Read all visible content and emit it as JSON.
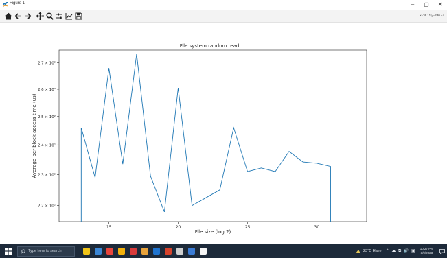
{
  "window": {
    "title": "Figure 1",
    "minimize": "–",
    "maximize": "▢",
    "close": "✕"
  },
  "toolbar": {
    "buttons": [
      "home-icon",
      "back-icon",
      "forward-icon",
      "pan-icon",
      "zoom-icon",
      "configure-subplots-icon",
      "edit-axis-icon",
      "save-icon"
    ],
    "coords": "x=36.11 y=230.44"
  },
  "chart_data": {
    "type": "line",
    "title": "File system random read",
    "xlabel": "File size (log 2)",
    "ylabel": "Average per block access time (us)",
    "xlim": [
      11.4,
      33.6
    ],
    "ylim": [
      215,
      275
    ],
    "yscale": "log",
    "grid": false,
    "legend": "none",
    "line_color": "#1f77b4",
    "x_ticks": [
      {
        "value": 15,
        "label": "15"
      },
      {
        "value": 20,
        "label": "20"
      },
      {
        "value": 25,
        "label": "25"
      },
      {
        "value": 30,
        "label": "30"
      }
    ],
    "y_ticks": [
      {
        "value": 220,
        "label": "2.2 × 10²"
      },
      {
        "value": 230,
        "label": "2.3 × 10²"
      },
      {
        "value": 240,
        "label": "2.4 × 10²"
      },
      {
        "value": 250,
        "label": "2.5 × 10²"
      },
      {
        "value": 260,
        "label": "2.6 × 10²"
      },
      {
        "value": 270,
        "label": "2.7 × 10²"
      }
    ],
    "series": [
      {
        "x": [
          13,
          13,
          14,
          15,
          16,
          17,
          18,
          19,
          20,
          21,
          22,
          23,
          24,
          25,
          26,
          27,
          28,
          29,
          30,
          31,
          31
        ],
        "y": [
          215,
          246,
          229,
          268,
          233.5,
          273.5,
          229.5,
          218,
          260.5,
          220,
          222.5,
          225,
          246,
          231,
          232.2,
          231,
          237.8,
          234.2,
          233.8,
          232.7,
          215
        ]
      }
    ]
  },
  "taskbar": {
    "search_placeholder": "Type here to search",
    "app_icon_colors": [
      "#f0c419",
      "#3c87d6",
      "#e8453c",
      "#f2b10c",
      "#d83b3b",
      "#e8a33c",
      "#1f74d0",
      "#d6432c",
      "#cfcfcf",
      "#3a7bd5",
      "#f5f5f5"
    ],
    "weather": "23°C Haze",
    "tray": "⌃ ☁ ⧉ 🔊 ▣",
    "time": "10:27 PM",
    "date": "3/9/2023"
  }
}
